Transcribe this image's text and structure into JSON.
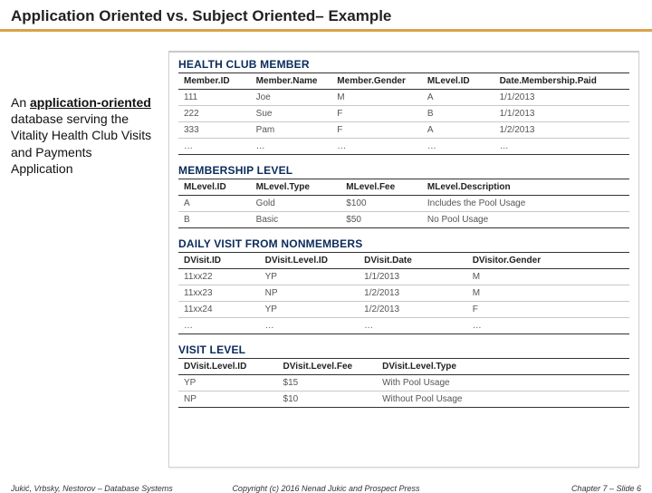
{
  "title": "Application Oriented vs. Subject Oriented– Example",
  "side": {
    "line1_prefix": "An ",
    "line1_bold": "application-oriented",
    "line1_rest": " database serving the Vitality Health Club Visits and Payments Application"
  },
  "tables": {
    "member": {
      "title": "HEALTH CLUB MEMBER",
      "headers": [
        "Member.ID",
        "Member.Name",
        "Member.Gender",
        "MLevel.ID",
        "Date.Membership.Paid"
      ],
      "rows": [
        [
          "111",
          "Joe",
          "M",
          "A",
          "1/1/2013"
        ],
        [
          "222",
          "Sue",
          "F",
          "B",
          "1/1/2013"
        ],
        [
          "333",
          "Pam",
          "F",
          "A",
          "1/2/2013"
        ],
        [
          "…",
          "…",
          "…",
          "…",
          "…"
        ]
      ]
    },
    "mlevel": {
      "title": "MEMBERSHIP LEVEL",
      "headers": [
        "MLevel.ID",
        "MLevel.Type",
        "MLevel.Fee",
        "MLevel.Description"
      ],
      "rows": [
        [
          "A",
          "Gold",
          "$100",
          "Includes the Pool Usage"
        ],
        [
          "B",
          "Basic",
          "$50",
          "No Pool Usage"
        ]
      ]
    },
    "dvisit": {
      "title": "DAILY VISIT FROM NONMEMBERS",
      "headers": [
        "DVisit.ID",
        "DVisit.Level.ID",
        "DVisit.Date",
        "DVisitor.Gender"
      ],
      "rows": [
        [
          "11xx22",
          "YP",
          "1/1/2013",
          "M"
        ],
        [
          "11xx23",
          "NP",
          "1/2/2013",
          "M"
        ],
        [
          "11xx24",
          "YP",
          "1/2/2013",
          "F"
        ],
        [
          "…",
          "…",
          "…",
          "…"
        ]
      ]
    },
    "vlevel": {
      "title": "VISIT LEVEL",
      "headers": [
        "DVisit.Level.ID",
        "DVisit.Level.Fee",
        "DVisit.Level.Type"
      ],
      "rows": [
        [
          "YP",
          "$15",
          "With Pool Usage"
        ],
        [
          "NP",
          "$10",
          "Without Pool Usage"
        ]
      ]
    }
  },
  "footer": {
    "left": "Jukić, Vrbsky, Nestorov – Database Systems",
    "center": "Copyright (c) 2016 Nenad Jukic and Prospect Press",
    "right": "Chapter 7 – Slide 6"
  }
}
